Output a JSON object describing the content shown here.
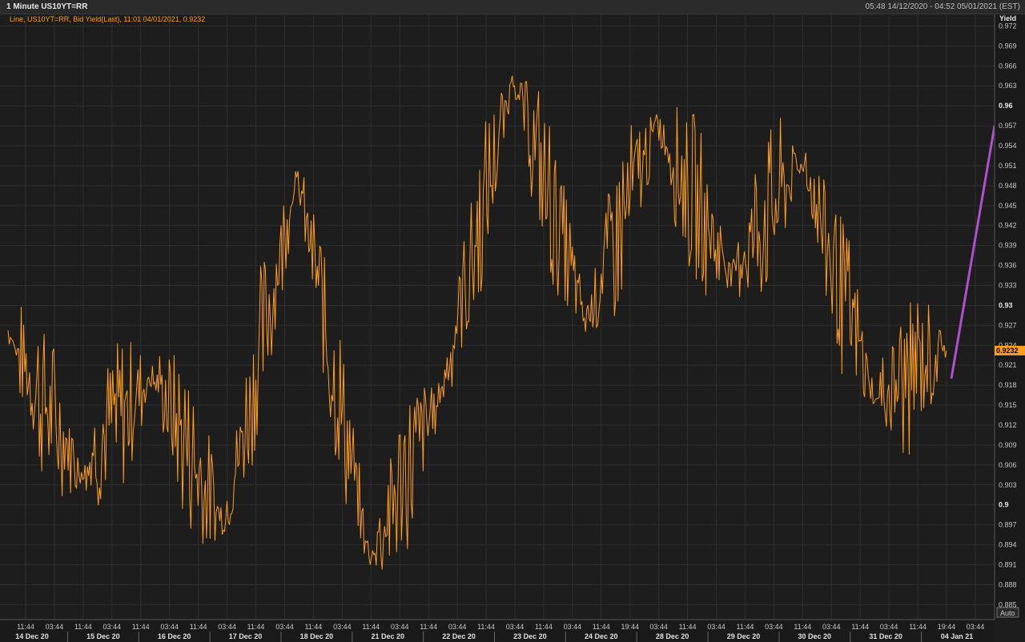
{
  "window": {
    "title": "1 Minute US10YT=RR",
    "date_range": "05:48 14/12/2020 - 04:52 05/01/2021 (EST)"
  },
  "legend": {
    "text": "Line, US10YT=RR, Bid Yield(Last), 11:01 04/01/2021, 0.9232"
  },
  "axis": {
    "y_label": "Yield",
    "auto_label": "Auto",
    "last_value_label": "0.9232",
    "y_ticks": [
      "0.972",
      "0.969",
      "0.966",
      "0.963",
      "0.96",
      "0.957",
      "0.954",
      "0.951",
      "0.948",
      "0.945",
      "0.942",
      "0.939",
      "0.936",
      "0.933",
      "0.93",
      "0.927",
      "0.924",
      "0.921",
      "0.918",
      "0.915",
      "0.912",
      "0.909",
      "0.906",
      "0.903",
      "0.9",
      "0.897",
      "0.894",
      "0.891",
      "0.888",
      "0.885"
    ],
    "x_time_ticks": [
      "11:44",
      "03:44",
      "11:44",
      "03:44",
      "11:44",
      "03:44",
      "11:44",
      "03:44",
      "11:44",
      "03:44",
      "11:44",
      "03:44",
      "11:44",
      "03:44",
      "11:44",
      "03:44",
      "11:44",
      "03:44",
      "11:44",
      "03:44",
      "11:44",
      "19:44",
      "03:44",
      "11:44",
      "03:44",
      "11:44",
      "03:44",
      "11:44",
      "03:44",
      "11:44",
      "03:44",
      "11:44",
      "19:44",
      "03:44"
    ],
    "x_date_labels": [
      "14 Dec 20",
      "15 Dec 20",
      "16 Dec 20",
      "17 Dec 20",
      "18 Dec 20",
      "21 Dec 20",
      "22 Dec 20",
      "23 Dec 20",
      "24 Dec 20",
      "28 Dec 20",
      "29 Dec 20",
      "30 Dec 20",
      "31 Dec 20",
      "04 Jan 21"
    ]
  },
  "colors": {
    "background": "#1d1d1d",
    "grid": "#2f2f2f",
    "series": "#ff9d1f",
    "trend": "#b04fd0",
    "last_value_bg": "#ff9d1f"
  },
  "chart_data": {
    "type": "line",
    "x_label": "",
    "ylabel": "Yield",
    "ylim": [
      0.883,
      0.9735
    ],
    "x": [
      "14 Dec 20",
      "15 Dec 20",
      "16 Dec 20",
      "17 Dec 20",
      "18 Dec 20",
      "21 Dec 20",
      "22 Dec 20",
      "23 Dec 20",
      "24 Dec 20",
      "28 Dec 20",
      "29 Dec 20",
      "30 Dec 20",
      "31 Dec 20",
      "04 Jan 21"
    ],
    "series": [
      {
        "name": "Line, US10YT=RR, Bid Yield(Last)",
        "values": [
          0.926,
          0.905,
          0.92,
          0.897,
          0.95,
          0.892,
          0.917,
          0.964,
          0.928,
          0.957,
          0.935,
          0.952,
          0.916,
          0.9232
        ]
      }
    ],
    "trend_line": {
      "from": 0.919,
      "to": 0.957
    },
    "grid": true,
    "legend_position": "top-left"
  }
}
